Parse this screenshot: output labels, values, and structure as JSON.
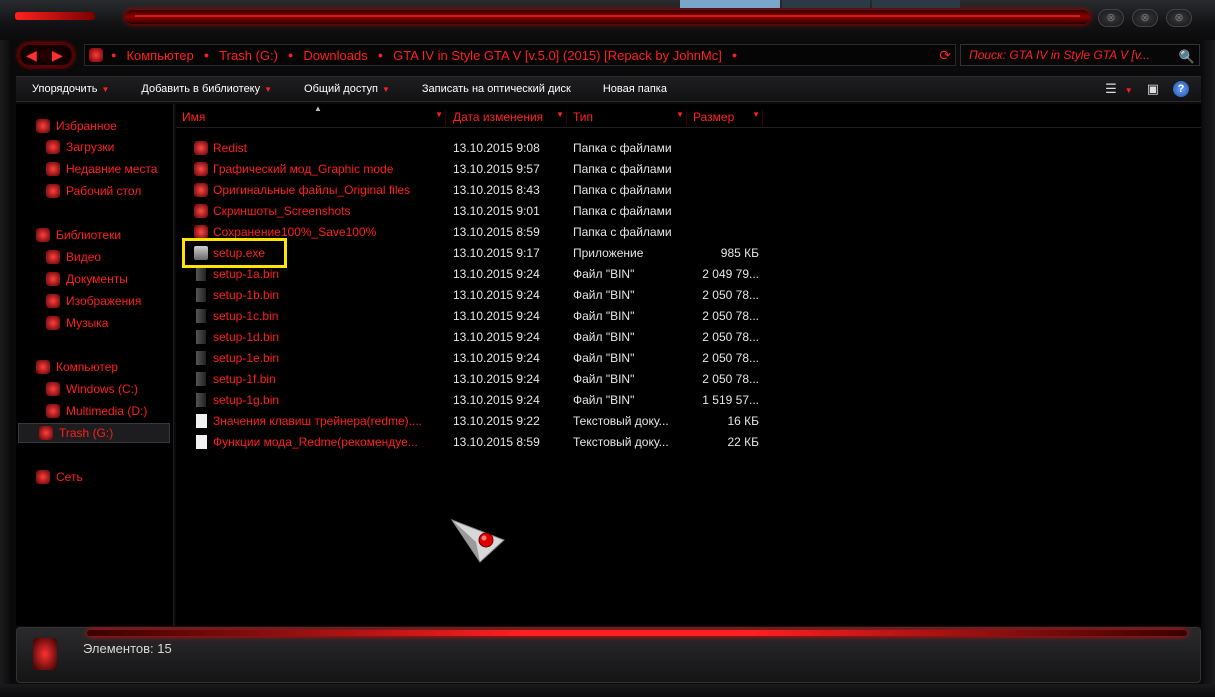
{
  "window": {
    "buttons": [
      "⊗",
      "⊗",
      "⊗"
    ]
  },
  "nav": {
    "back": "◀",
    "forward": "▶",
    "refresh": "⟳"
  },
  "address": {
    "crumbs": [
      "Компьютер",
      "Trash (G:)",
      "Downloads",
      "GTA IV in Style GTA V [v.5.0] (2015) [Repack by JohnMc]"
    ]
  },
  "search": {
    "placeholder": "Поиск: GTA IV in Style GTA V [v...",
    "icon": "search-icon"
  },
  "toolbar": {
    "organize": "Упорядочить",
    "add_to_library": "Добавить в библиотеку",
    "share": "Общий доступ",
    "burn": "Записать на оптический диск",
    "new_folder": "Новая папка",
    "help": "?"
  },
  "sidebar": {
    "favorites": "Избранное",
    "downloads": "Загрузки",
    "recent": "Недавние места",
    "desktop": "Рабочий стол",
    "libraries": "Библиотеки",
    "video": "Видео",
    "documents": "Документы",
    "images": "Изображения",
    "music": "Музыка",
    "computer": "Компьютер",
    "drive_c": "Windows (C:)",
    "drive_d": "Multimedia (D:)",
    "drive_g": "Trash (G:)",
    "network": "Сеть"
  },
  "columns": {
    "name": "Имя",
    "date": "Дата изменения",
    "type": "Тип",
    "size": "Размер"
  },
  "files": [
    {
      "name": "Redist",
      "date": "13.10.2015 9:08",
      "type": "Папка с файлами",
      "size": "",
      "icon": "folder-icon"
    },
    {
      "name": "Графический мод_Graphic mode",
      "date": "13.10.2015 9:57",
      "type": "Папка с файлами",
      "size": "",
      "icon": "folder-icon"
    },
    {
      "name": "Оригинальные файлы_Original files",
      "date": "13.10.2015 8:43",
      "type": "Папка с файлами",
      "size": "",
      "icon": "folder-icon"
    },
    {
      "name": "Скриншоты_Screenshots",
      "date": "13.10.2015 9:01",
      "type": "Папка с файлами",
      "size": "",
      "icon": "folder-icon"
    },
    {
      "name": "Сохранение100%_Save100%",
      "date": "13.10.2015 8:59",
      "type": "Папка с файлами",
      "size": "",
      "icon": "folder-icon"
    },
    {
      "name": "setup.exe",
      "date": "13.10.2015 9:17",
      "type": "Приложение",
      "size": "985 КБ",
      "icon": "exe-icon"
    },
    {
      "name": "setup-1a.bin",
      "date": "13.10.2015 9:24",
      "type": "Файл \"BIN\"",
      "size": "2 049 79...",
      "icon": "bin-file-icon"
    },
    {
      "name": "setup-1b.bin",
      "date": "13.10.2015 9:24",
      "type": "Файл \"BIN\"",
      "size": "2 050 78...",
      "icon": "bin-file-icon"
    },
    {
      "name": "setup-1c.bin",
      "date": "13.10.2015 9:24",
      "type": "Файл \"BIN\"",
      "size": "2 050 78...",
      "icon": "bin-file-icon"
    },
    {
      "name": "setup-1d.bin",
      "date": "13.10.2015 9:24",
      "type": "Файл \"BIN\"",
      "size": "2 050 78...",
      "icon": "bin-file-icon"
    },
    {
      "name": "setup-1e.bin",
      "date": "13.10.2015 9:24",
      "type": "Файл \"BIN\"",
      "size": "2 050 78...",
      "icon": "bin-file-icon"
    },
    {
      "name": "setup-1f.bin",
      "date": "13.10.2015 9:24",
      "type": "Файл \"BIN\"",
      "size": "2 050 78...",
      "icon": "bin-file-icon"
    },
    {
      "name": "setup-1g.bin",
      "date": "13.10.2015 9:24",
      "type": "Файл \"BIN\"",
      "size": "1 519 57...",
      "icon": "bin-file-icon"
    },
    {
      "name": "Значения клавиш трейнера(redme)....",
      "date": "13.10.2015 9:22",
      "type": "Текстовый доку...",
      "size": "16 КБ",
      "icon": "text-file-icon"
    },
    {
      "name": "Функции мода_Redme(рекомендуе...",
      "date": "13.10.2015 8:59",
      "type": "Текстовый доку...",
      "size": "22 КБ",
      "icon": "text-file-icon"
    }
  ],
  "status": {
    "items_count": "Элементов: 15"
  },
  "colors": {
    "accent": "#ff2020",
    "highlight": "#ffe400",
    "background": "#000000"
  }
}
